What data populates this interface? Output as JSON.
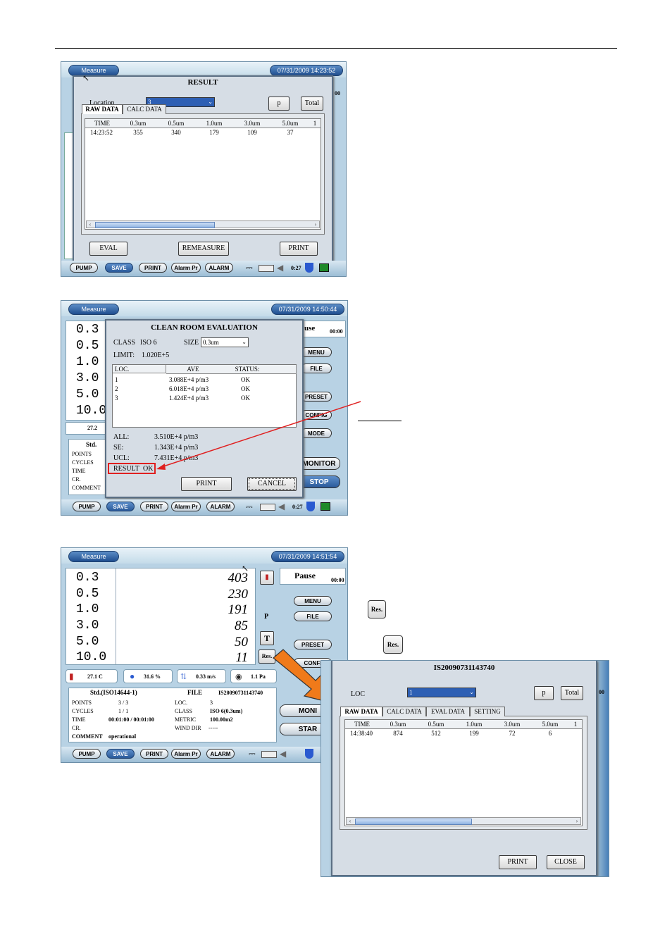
{
  "screen1": {
    "header_label": "Measure",
    "datetime": "07/31/2009 14:23:52",
    "dialog_title": "RESULT",
    "location_label": "Location",
    "location_value": "3",
    "p_button": "p",
    "total_button": "Total",
    "tabs": [
      "RAW DATA",
      "CALC DATA"
    ],
    "columns": [
      "TIME",
      "0.3um",
      "0.5um",
      "1.0um",
      "3.0um",
      "5.0um",
      "1"
    ],
    "rows": [
      [
        "14:23:52",
        "355",
        "340",
        "179",
        "109",
        "37"
      ]
    ],
    "side_value": "00",
    "buttons": {
      "eval": "EVAL",
      "remeasure": "REMEASURE",
      "print": "PRINT"
    },
    "bottom_buttons": [
      "PUMP",
      "SAVE",
      "PRINT",
      "Alarm Pr",
      "ALARM"
    ],
    "clock": "0:27"
  },
  "screen2": {
    "header_label": "Measure",
    "datetime": "07/31/2009 14:50:44",
    "dialog_title": "CLEAN ROOM EVALUATION",
    "class_label": "CLASS",
    "class_value": "ISO 6",
    "size_label": "SIZE",
    "size_value": "0.3um",
    "limit_label": "LIMIT:",
    "limit_value": "1.020E+5",
    "columns": [
      "LOC.",
      "AVE",
      "STATUS:"
    ],
    "rows": [
      [
        "1",
        "3.088E+4 p/m3",
        "OK"
      ],
      [
        "2",
        "6.018E+4 p/m3",
        "OK"
      ],
      [
        "3",
        "1.424E+4 p/m3",
        "OK"
      ]
    ],
    "all_label": "ALL:",
    "all_value": "3.510E+4 p/m3",
    "se_label": "SE:",
    "se_value": "1.343E+4 p/m3",
    "ucl_label": "UCL:",
    "ucl_value": "7.431E+4 p/m3",
    "result_label": "RESULT",
    "result_value": "OK",
    "buttons": {
      "print": "PRINT",
      "cancel": "CANCEL"
    },
    "bg_sizes": [
      "0.3",
      "0.5",
      "1.0",
      "3.0",
      "5.0",
      "10.0"
    ],
    "bg_temp": "27.2",
    "bg_std": "Std.",
    "bg_info_labels": [
      "POINTS",
      "CYCLES",
      "TIME",
      "CR.",
      "COMMENT"
    ],
    "right_status": "use",
    "right_timer": "00:00",
    "right_buttons": [
      "MENU",
      "FILE",
      "PRESET",
      "CONFIG",
      "MODE"
    ],
    "monitor": "MONITOR",
    "stop": "STOP",
    "bottom_buttons": [
      "PUMP",
      "SAVE",
      "PRINT",
      "Alarm Pr",
      "ALARM"
    ],
    "clock": "0:27",
    "accent_red": "#e02020"
  },
  "screen3": {
    "header_label": "Measure",
    "datetime": "07/31/2009 14:51:54",
    "sizes": [
      "0.3",
      "0.5",
      "1.0",
      "3.0",
      "5.0",
      "10.0"
    ],
    "counts": [
      "403",
      "230",
      "191",
      "85",
      "50",
      "11"
    ],
    "p_label": "P",
    "t_label": "T",
    "res_label": "Res.",
    "status": "Pause",
    "timer": "00:00",
    "right_buttons": [
      "MENU",
      "FILE",
      "PRESET",
      "CONFI"
    ],
    "monitor": "MONI",
    "start": "STAR",
    "env": {
      "temp": "27.1 C",
      "humidity": "31.6 %",
      "velocity": "0.33 m/s",
      "pressure": "1.1 Pa"
    },
    "std_label": "Std.(ISO14644-1)",
    "file_label": "FILE",
    "file_value": "IS20090731143740",
    "info_left": [
      {
        "label": "POINTS",
        "value": "3 / 3"
      },
      {
        "label": "CYCLES",
        "value": "1 / 1"
      },
      {
        "label": "TIME",
        "value": "00:01:00  /  00:01:00"
      },
      {
        "label": "CR.",
        "value": ""
      },
      {
        "label": "COMMENT",
        "value": "operational"
      }
    ],
    "info_right": [
      {
        "label": "LOC.",
        "value": "3"
      },
      {
        "label": "CLASS",
        "value": "ISO 6(0.3um)"
      },
      {
        "label": "METRIC",
        "value": "100.00m2"
      },
      {
        "label": "WIND DIR",
        "value": "-----"
      }
    ],
    "bottom_buttons": [
      "PUMP",
      "SAVE",
      "PRINT",
      "Alarm Pr",
      "ALARM"
    ]
  },
  "screen4": {
    "title": "IS20090731143740",
    "loc_label": "LOC",
    "loc_value": "1",
    "p_button": "p",
    "total_button": "Total",
    "side_value": "00",
    "tabs": [
      "RAW DATA",
      "CALC DATA",
      "EVAL DATA",
      "SETTING"
    ],
    "columns": [
      "TIME",
      "0.3um",
      "0.5um",
      "1.0um",
      "3.0um",
      "5.0um",
      "1"
    ],
    "rows": [
      [
        "14:38:40",
        "874",
        "512",
        "199",
        "72",
        "6"
      ]
    ],
    "buttons": {
      "print": "PRINT",
      "close": "CLOSE"
    }
  },
  "res_icon_label": "Res.",
  "colors": {
    "arrow_orange": "#f07a1a",
    "screen_blue": "#b8d2e4",
    "header_blue": "#2a5a9a"
  }
}
